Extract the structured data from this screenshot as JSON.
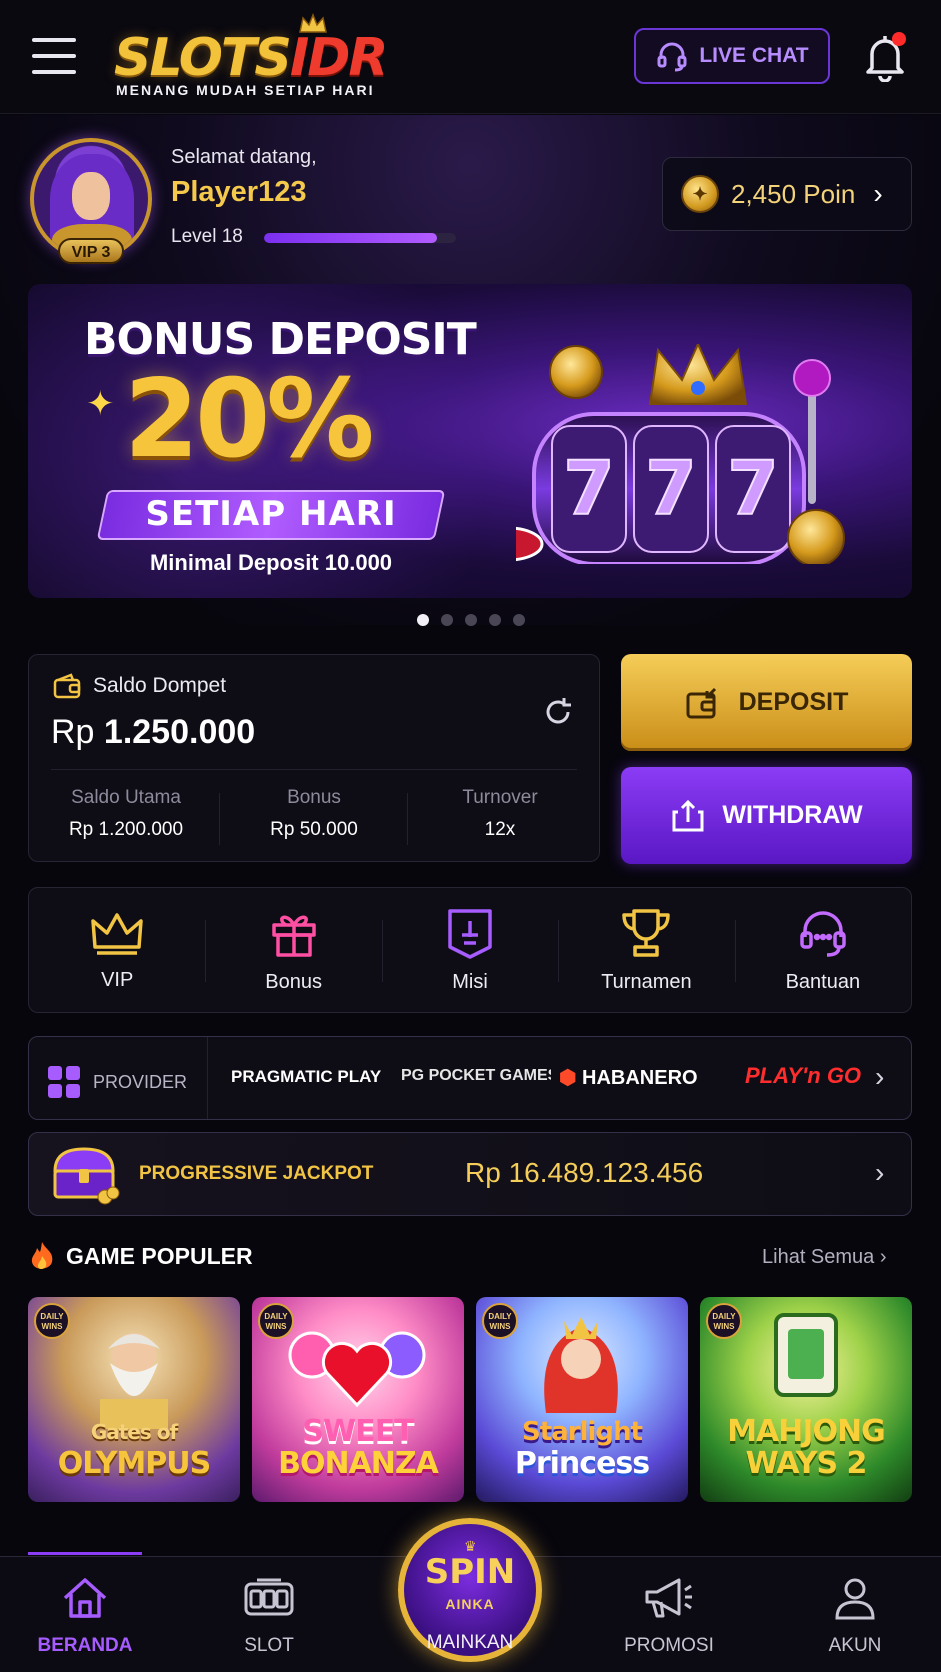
{
  "header": {
    "logo_text_gold": "SLOTS",
    "logo_text_red": "IDR",
    "logo_tagline": "MENANG MUDAH SETIAP HARI",
    "live_chat_label": "LIVE CHAT",
    "notification_dot": true
  },
  "profile": {
    "welcome": "Selamat datang,",
    "username": "Player123",
    "level_label": "Level 18",
    "level_progress": 0.9,
    "vip_badge": "VIP 3",
    "points": "2,450 Poin"
  },
  "banner": {
    "title": "BONUS DEPOSIT",
    "percent": "20%",
    "ribbon": "SETIAP HARI",
    "subtitle": "Minimal Deposit 10.000",
    "reel_digits": [
      "7",
      "7",
      "7"
    ],
    "slide_count": 5,
    "active_slide": 0
  },
  "wallet": {
    "label": "Saldo Dompet",
    "currency": "Rp",
    "amount": "1.250.000",
    "columns": [
      {
        "label": "Saldo Utama",
        "value": "Rp 1.200.000"
      },
      {
        "label": "Bonus",
        "value": "Rp 50.000"
      },
      {
        "label": "Turnover",
        "value": "12x"
      }
    ]
  },
  "actions": {
    "deposit_label": "DEPOSIT",
    "withdraw_label": "WITHDRAW"
  },
  "quick_menu": [
    {
      "label": "VIP",
      "icon": "crown-icon",
      "color": "#f2c443"
    },
    {
      "label": "Bonus",
      "icon": "gift-icon",
      "color": "#ff4fa3"
    },
    {
      "label": "Misi",
      "icon": "mission-shield-icon",
      "color": "#a65cff"
    },
    {
      "label": "Turnamen",
      "icon": "trophy-icon",
      "color": "#f2c443"
    },
    {
      "label": "Bantuan",
      "icon": "headset-icon",
      "color": "#c46bff"
    }
  ],
  "providers": {
    "label": "PROVIDER",
    "items": [
      "PRAGMATIC PLAY",
      "PG POCKET GAMES SOFT",
      "HABANERO",
      "PLAY'n GO"
    ]
  },
  "jackpot": {
    "label": "PROGRESSIVE JACKPOT",
    "value": "Rp 16.489.123.456"
  },
  "popular": {
    "title": "GAME POPULER",
    "see_all": "Lihat Semua",
    "games": [
      {
        "line1": "Gates of",
        "line2": "OLYMPUS",
        "badge": "DAILY WINS"
      },
      {
        "line1": "SWEET",
        "line2": "BONANZA",
        "badge": "DAILY WINS"
      },
      {
        "line1": "Starlight",
        "line2": "Princess",
        "badge": "DAILY WINS"
      },
      {
        "line1": "MAHJONG",
        "line2": "WAYS 2",
        "badge": "DAILY WINS"
      }
    ]
  },
  "bottom_nav": {
    "home": "BERANDA",
    "slot": "SLOT",
    "spin_text": "SPIN",
    "spin_sub": "AINKA",
    "spin_label": "MAINKAN",
    "promo": "PROMOSI",
    "account": "AKUN"
  },
  "colors": {
    "accent_purple": "#8b3cf5",
    "accent_gold": "#f2c443",
    "background": "#07060d"
  }
}
